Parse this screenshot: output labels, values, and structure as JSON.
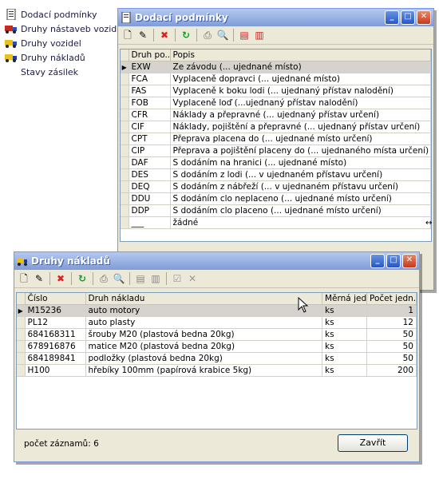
{
  "tree": {
    "items": [
      {
        "label": "Dodací podmínky",
        "icon": "document-icon"
      },
      {
        "label": "Druhy nástaveb vozidel",
        "icon": "truck-red-icon"
      },
      {
        "label": "Druhy vozidel",
        "icon": "truck-yellow-icon"
      },
      {
        "label": "Druhy nákladů",
        "icon": "truck-blue-icon"
      },
      {
        "label": "Stavy zásilek",
        "icon": ""
      }
    ]
  },
  "win1": {
    "title": "Dodací podmínky",
    "columns": [
      "Druh po...",
      "Popis"
    ],
    "rows": [
      {
        "code": "EXW",
        "desc": "Ze závodu (... ujednané místo)"
      },
      {
        "code": "FCA",
        "desc": "Vyplaceně dopravci (... ujednané místo)"
      },
      {
        "code": "FAS",
        "desc": "Vyplaceně k boku lodi (... ujednaný přístav nalodění)"
      },
      {
        "code": "FOB",
        "desc": "Vyplaceně loď (...ujednaný přístav nalodění)"
      },
      {
        "code": "CFR",
        "desc": "Náklady a přepravné (... ujednaný přístav určení)"
      },
      {
        "code": "CIF",
        "desc": "Náklady, pojištění a přepravné (... ujednaný přístav určení)"
      },
      {
        "code": "CPT",
        "desc": "Přeprava placena do (... ujednané místo určení)"
      },
      {
        "code": "CIP",
        "desc": "Přeprava a pojištění placeny do (... ujednaného místa určení)"
      },
      {
        "code": "DAF",
        "desc": "S dodáním na hranici (... ujednané místo)"
      },
      {
        "code": "DES",
        "desc": "S dodáním z lodi (... v ujednaném přístavu určení)"
      },
      {
        "code": "DEQ",
        "desc": "S dodáním z nábřeží (... v ujednaném přístavu určení)"
      },
      {
        "code": "DDU",
        "desc": "S dodáním clo neplaceno (... ujednané místo určení)"
      },
      {
        "code": "DDP",
        "desc": "S dodáním clo placeno (... ujednané místo určení)"
      },
      {
        "code": "___",
        "desc": "žádné"
      }
    ]
  },
  "win2": {
    "title": "Druhy nákladů",
    "columns": [
      "Číslo",
      "Druh nákladu",
      "Měrná jed...",
      "Počet jedn..."
    ],
    "rows": [
      {
        "cislo": "M15236",
        "druh": "auto motory",
        "mj": "ks",
        "pocet": "1"
      },
      {
        "cislo": "PL12",
        "druh": "auto plasty",
        "mj": "ks",
        "pocet": "12"
      },
      {
        "cislo": "684168311",
        "druh": "šrouby M20 (plastová bedna 20kg)",
        "mj": "ks",
        "pocet": "50"
      },
      {
        "cislo": "678916876",
        "druh": "matice M20  (plastová bedna 20kg)",
        "mj": "ks",
        "pocet": "50"
      },
      {
        "cislo": "684189841",
        "druh": "podložky  (plastová bedna 20kg)",
        "mj": "ks",
        "pocet": "50"
      },
      {
        "cislo": "H100",
        "druh": "hřebíky 100mm (papírová krabice 5kg)",
        "mj": "ks",
        "pocet": "200"
      }
    ],
    "record_count_label": "počet záznamů:",
    "record_count": "6",
    "close_button": "Zavřít"
  },
  "colors": {
    "titlebar": "#7f9cd8",
    "selected_row": "#d6d3ce",
    "window_bg": "#ece9d8"
  }
}
